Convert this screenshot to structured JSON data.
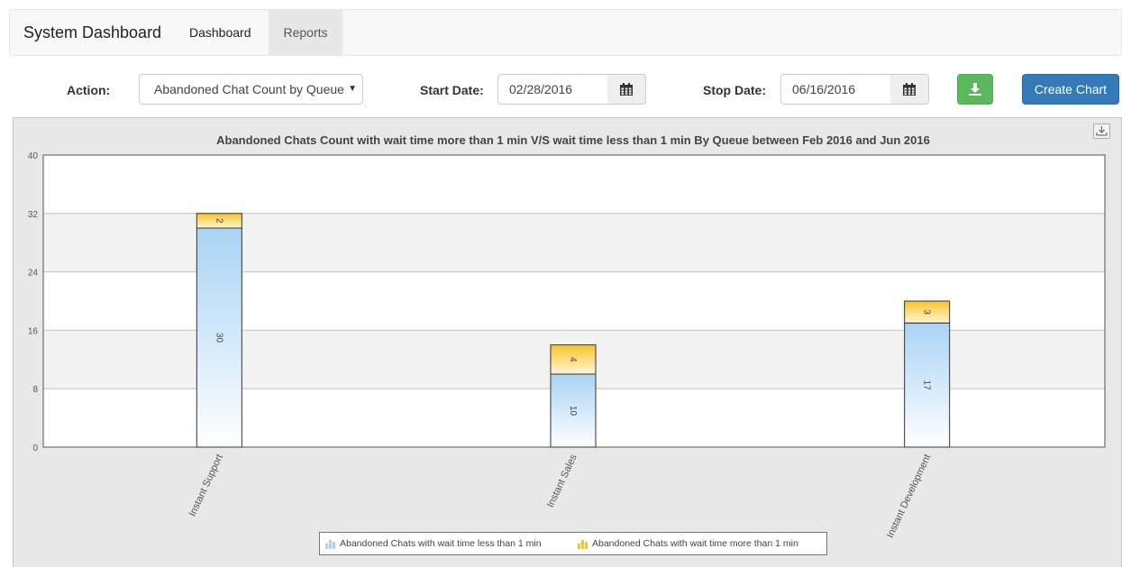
{
  "navbar": {
    "brand": "System Dashboard",
    "tabs": [
      {
        "label": "Dashboard",
        "active": false
      },
      {
        "label": "Reports",
        "active": true
      }
    ]
  },
  "toolbar": {
    "action_label": "Action:",
    "action_value": "Abandoned Chat Count by Queue",
    "start_label": "Start Date:",
    "start_value": "02/28/2016",
    "stop_label": "Stop Date:",
    "stop_value": "06/16/2016",
    "create_label": "Create Chart",
    "download_icon": "download-icon",
    "calendar_icon": "calendar-icon",
    "download_color": "#5cb85c",
    "create_color": "#337ab7"
  },
  "chart_data": {
    "type": "bar",
    "stacked": true,
    "title": "Abandoned Chats Count with wait time more than 1 min V/S wait time less than 1 min By Queue between Feb 2016 and Jun 2016",
    "categories": [
      "Instant Support",
      "Instant Sales",
      "Instant Development"
    ],
    "series": [
      {
        "name": "Abandoned Chats with wait time less than 1 min",
        "values": [
          30,
          10,
          17
        ],
        "color": "#a9d3f5"
      },
      {
        "name": "Abandoned Chats with wait time more than 1 min",
        "values": [
          2,
          4,
          3
        ],
        "color": "#f6c42a"
      }
    ],
    "ylim": [
      0,
      40
    ],
    "yticks": [
      0,
      8,
      16,
      24,
      32,
      40
    ],
    "grid": true,
    "legend_position": "bottom-center"
  }
}
